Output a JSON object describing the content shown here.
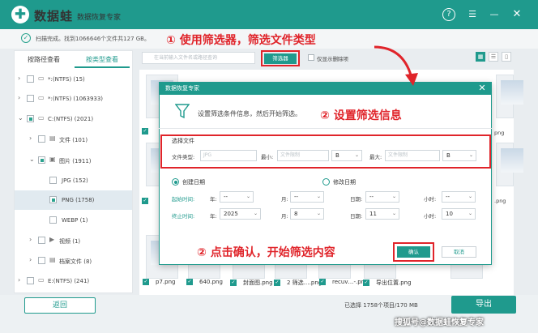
{
  "app": {
    "name": "数据蛙",
    "subtitle": "数据恢复专家",
    "logo_glyph": "✚",
    "accent_color": "#1f9a8d",
    "highlight_color": "#e0242a"
  },
  "titlebar": {
    "help_glyph": "?",
    "menu_glyph": "☰",
    "minimize_glyph": "—",
    "close_glyph": "✕"
  },
  "status": {
    "check_glyph": "✓",
    "text": "扫描完成。找到1066646个文件共127 GB。"
  },
  "view_tabs": {
    "by_path": "按路径查看",
    "by_type": "按类型查看"
  },
  "tree": [
    {
      "arrow": "›",
      "icon": "▭",
      "label": "*:(NTFS) (15)"
    },
    {
      "arrow": "›",
      "icon": "▭",
      "label": "*:(NTFS) (1063933)"
    },
    {
      "arrow": "⌄",
      "icon": "▭",
      "label": "C:(NTFS) (2021)"
    },
    {
      "arrow": "›",
      "icon": "▤",
      "label": "文件 (101)"
    },
    {
      "arrow": "⌄",
      "icon": "▣",
      "label": "图片 (1911)"
    },
    {
      "arrow": "",
      "icon": "",
      "label": "JPG (152)"
    },
    {
      "arrow": "",
      "icon": "",
      "label": "PNG (1758)"
    },
    {
      "arrow": "",
      "icon": "",
      "label": "WEBP (1)"
    },
    {
      "arrow": "›",
      "icon": "▶",
      "label": "视频 (1)"
    },
    {
      "arrow": "›",
      "icon": "▤",
      "label": "档案文件 (8)"
    },
    {
      "arrow": "›",
      "icon": "▭",
      "label": "E:(NTFS) (241)"
    }
  ],
  "toolbar": {
    "search_placeholder": "在当前输入文件名或路径查询",
    "search_glyph": "⌕",
    "filter_label": "筛选器",
    "show_deleted_label": "仅显示删除项",
    "view_grid": "▦",
    "view_list": "☰",
    "view_detail": "▯"
  },
  "grid_labels": {
    "png_a": "png",
    "png_b": ".png",
    "png_c": "png",
    "png_d": "png"
  },
  "files": [
    "p7.png",
    "640.png",
    "封面图.png",
    "2 筛选….png",
    "recuv…-.png",
    "导出位置.png"
  ],
  "dialog": {
    "title": "数据恢复专家",
    "close_glyph": "✕",
    "tip": "设置筛选条件信息，然后开始筛选。",
    "section_file": "选择文件",
    "file_type_label": "文件类型:",
    "file_type_placeholder": "JPG",
    "min_label": "最小:",
    "min_placeholder": "文件限制",
    "min_unit": "B",
    "max_label": "最大:",
    "max_placeholder": "文件限制",
    "max_unit": "B",
    "radio_created": "创建日期",
    "radio_modified": "修改日期",
    "start_label": "起始时间:",
    "end_label": "终止时间:",
    "year_label": "年:",
    "month_label": "月:",
    "day_label": "日期:",
    "hour_label": "小时:",
    "start_year": "--",
    "start_month": "--",
    "start_day": "--",
    "start_hour": "--",
    "end_year": "2025",
    "end_month": "8",
    "end_day": "11",
    "end_hour": "10",
    "chevron": "⌄",
    "confirm": "确认",
    "cancel": "取消"
  },
  "annotations": {
    "step1": "① 使用筛选器，筛选文件类型",
    "step2": "② 设置筛选信息",
    "step3": "② 点击确认，开始筛选内容"
  },
  "bottom": {
    "back": "返回",
    "selected_info": "已选择 1758个项目/170 MB",
    "export": "导出",
    "watermark": "搜狐号@数据蛙恢复专家"
  }
}
